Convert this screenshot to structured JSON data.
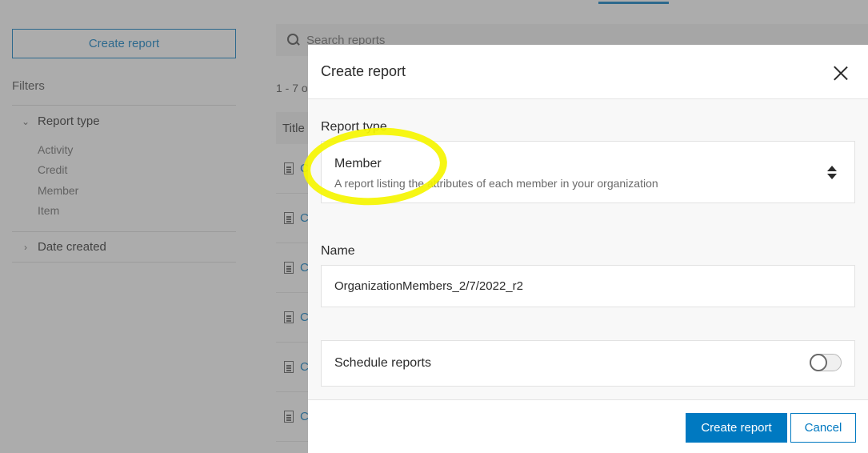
{
  "background": {
    "sidebar": {
      "create_button": "Create report",
      "filters_title": "Filters",
      "report_type_group": "Report type",
      "report_type_items": [
        "Activity",
        "Credit",
        "Member",
        "Item"
      ],
      "date_created_group": "Date created"
    },
    "search": {
      "placeholder": "Search reports"
    },
    "results_count": "1 - 7 o",
    "table": {
      "title_header": "Title",
      "row_link_fragment": "C"
    }
  },
  "modal": {
    "title": "Create report",
    "report_type": {
      "label": "Report type",
      "selected_value": "Member",
      "selected_description": "A report listing the attributes of each member in your organization"
    },
    "name": {
      "label": "Name",
      "value": "OrganizationMembers_2/7/2022_r2"
    },
    "schedule": {
      "label": "Schedule reports",
      "enabled": false
    },
    "footer": {
      "primary_button": "Create report",
      "secondary_button": "Cancel"
    }
  },
  "colors": {
    "accent": "#0079c1",
    "highlight": "#f5f500"
  }
}
